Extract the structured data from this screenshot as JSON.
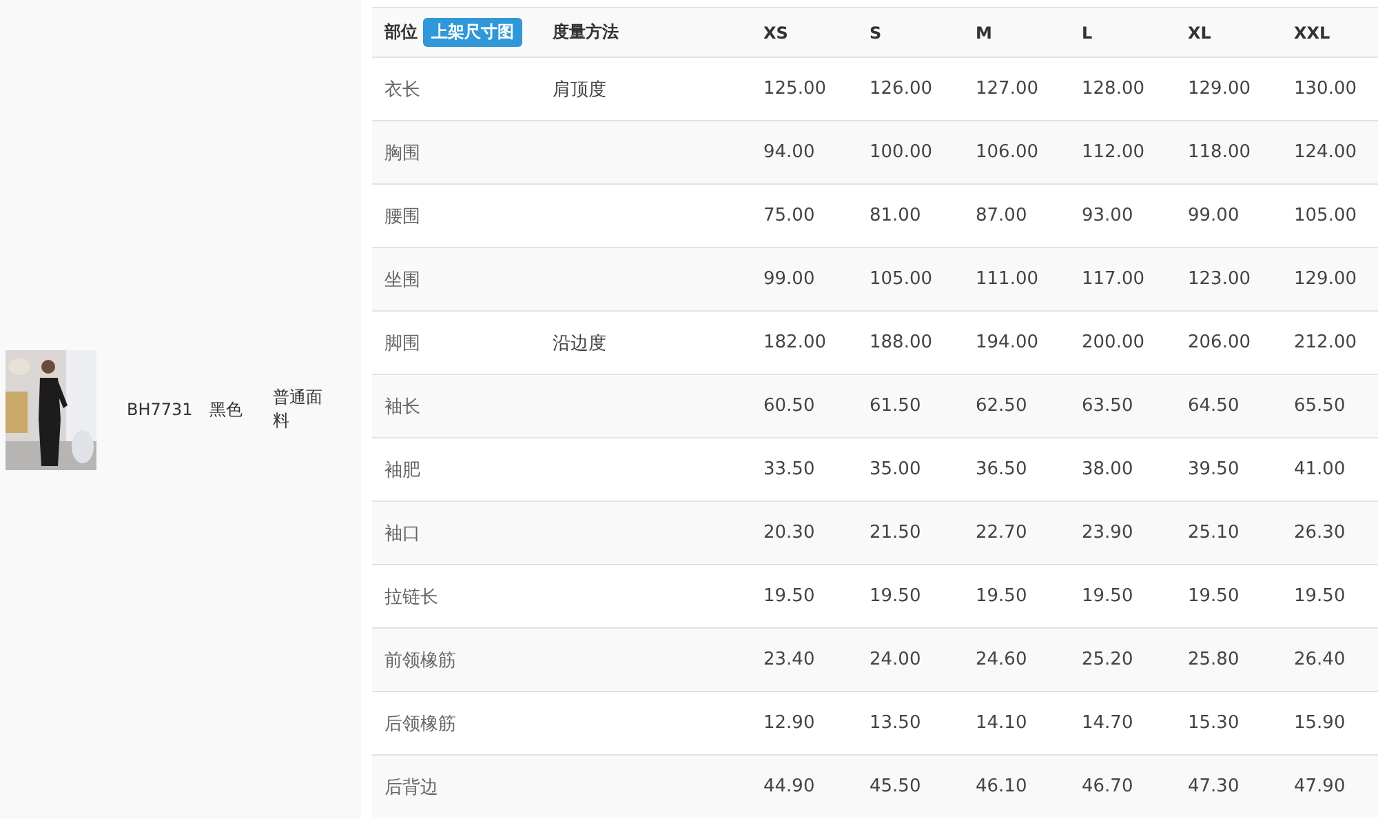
{
  "product": {
    "code": "BH7731",
    "color_name": "黑色",
    "fabric": "普通面料"
  },
  "table": {
    "columns": {
      "part": "部位",
      "badge": "上架尺寸图",
      "method": "度量方法",
      "sizes": [
        "XS",
        "S",
        "M",
        "L",
        "XL",
        "XXL"
      ]
    },
    "rows": [
      {
        "part": "衣长",
        "method": "肩顶度",
        "values": [
          "125.00",
          "126.00",
          "127.00",
          "128.00",
          "129.00",
          "130.00"
        ]
      },
      {
        "part": "胸围",
        "values": [
          "94.00",
          "100.00",
          "106.00",
          "112.00",
          "118.00",
          "124.00"
        ]
      },
      {
        "part": "腰围",
        "values": [
          "75.00",
          "81.00",
          "87.00",
          "93.00",
          "99.00",
          "105.00"
        ]
      },
      {
        "part": "坐围",
        "values": [
          "99.00",
          "105.00",
          "111.00",
          "117.00",
          "123.00",
          "129.00"
        ]
      },
      {
        "part": "脚围",
        "method": "沿边度",
        "values": [
          "182.00",
          "188.00",
          "194.00",
          "200.00",
          "206.00",
          "212.00"
        ]
      },
      {
        "part": "袖长",
        "values": [
          "60.50",
          "61.50",
          "62.50",
          "63.50",
          "64.50",
          "65.50"
        ]
      },
      {
        "part": "袖肥",
        "values": [
          "33.50",
          "35.00",
          "36.50",
          "38.00",
          "39.50",
          "41.00"
        ]
      },
      {
        "part": "袖口",
        "values": [
          "20.30",
          "21.50",
          "22.70",
          "23.90",
          "25.10",
          "26.30"
        ]
      },
      {
        "part": "拉链长",
        "values": [
          "19.50",
          "19.50",
          "19.50",
          "19.50",
          "19.50",
          "19.50"
        ]
      },
      {
        "part": "前领橡筋",
        "values": [
          "23.40",
          "24.00",
          "24.60",
          "25.20",
          "25.80",
          "26.40"
        ]
      },
      {
        "part": "后领橡筋",
        "values": [
          "12.90",
          "13.50",
          "14.10",
          "14.70",
          "15.30",
          "15.90"
        ]
      },
      {
        "part": "后背边",
        "values": [
          "44.90",
          "45.50",
          "46.10",
          "46.70",
          "47.30",
          "47.90"
        ]
      }
    ]
  }
}
